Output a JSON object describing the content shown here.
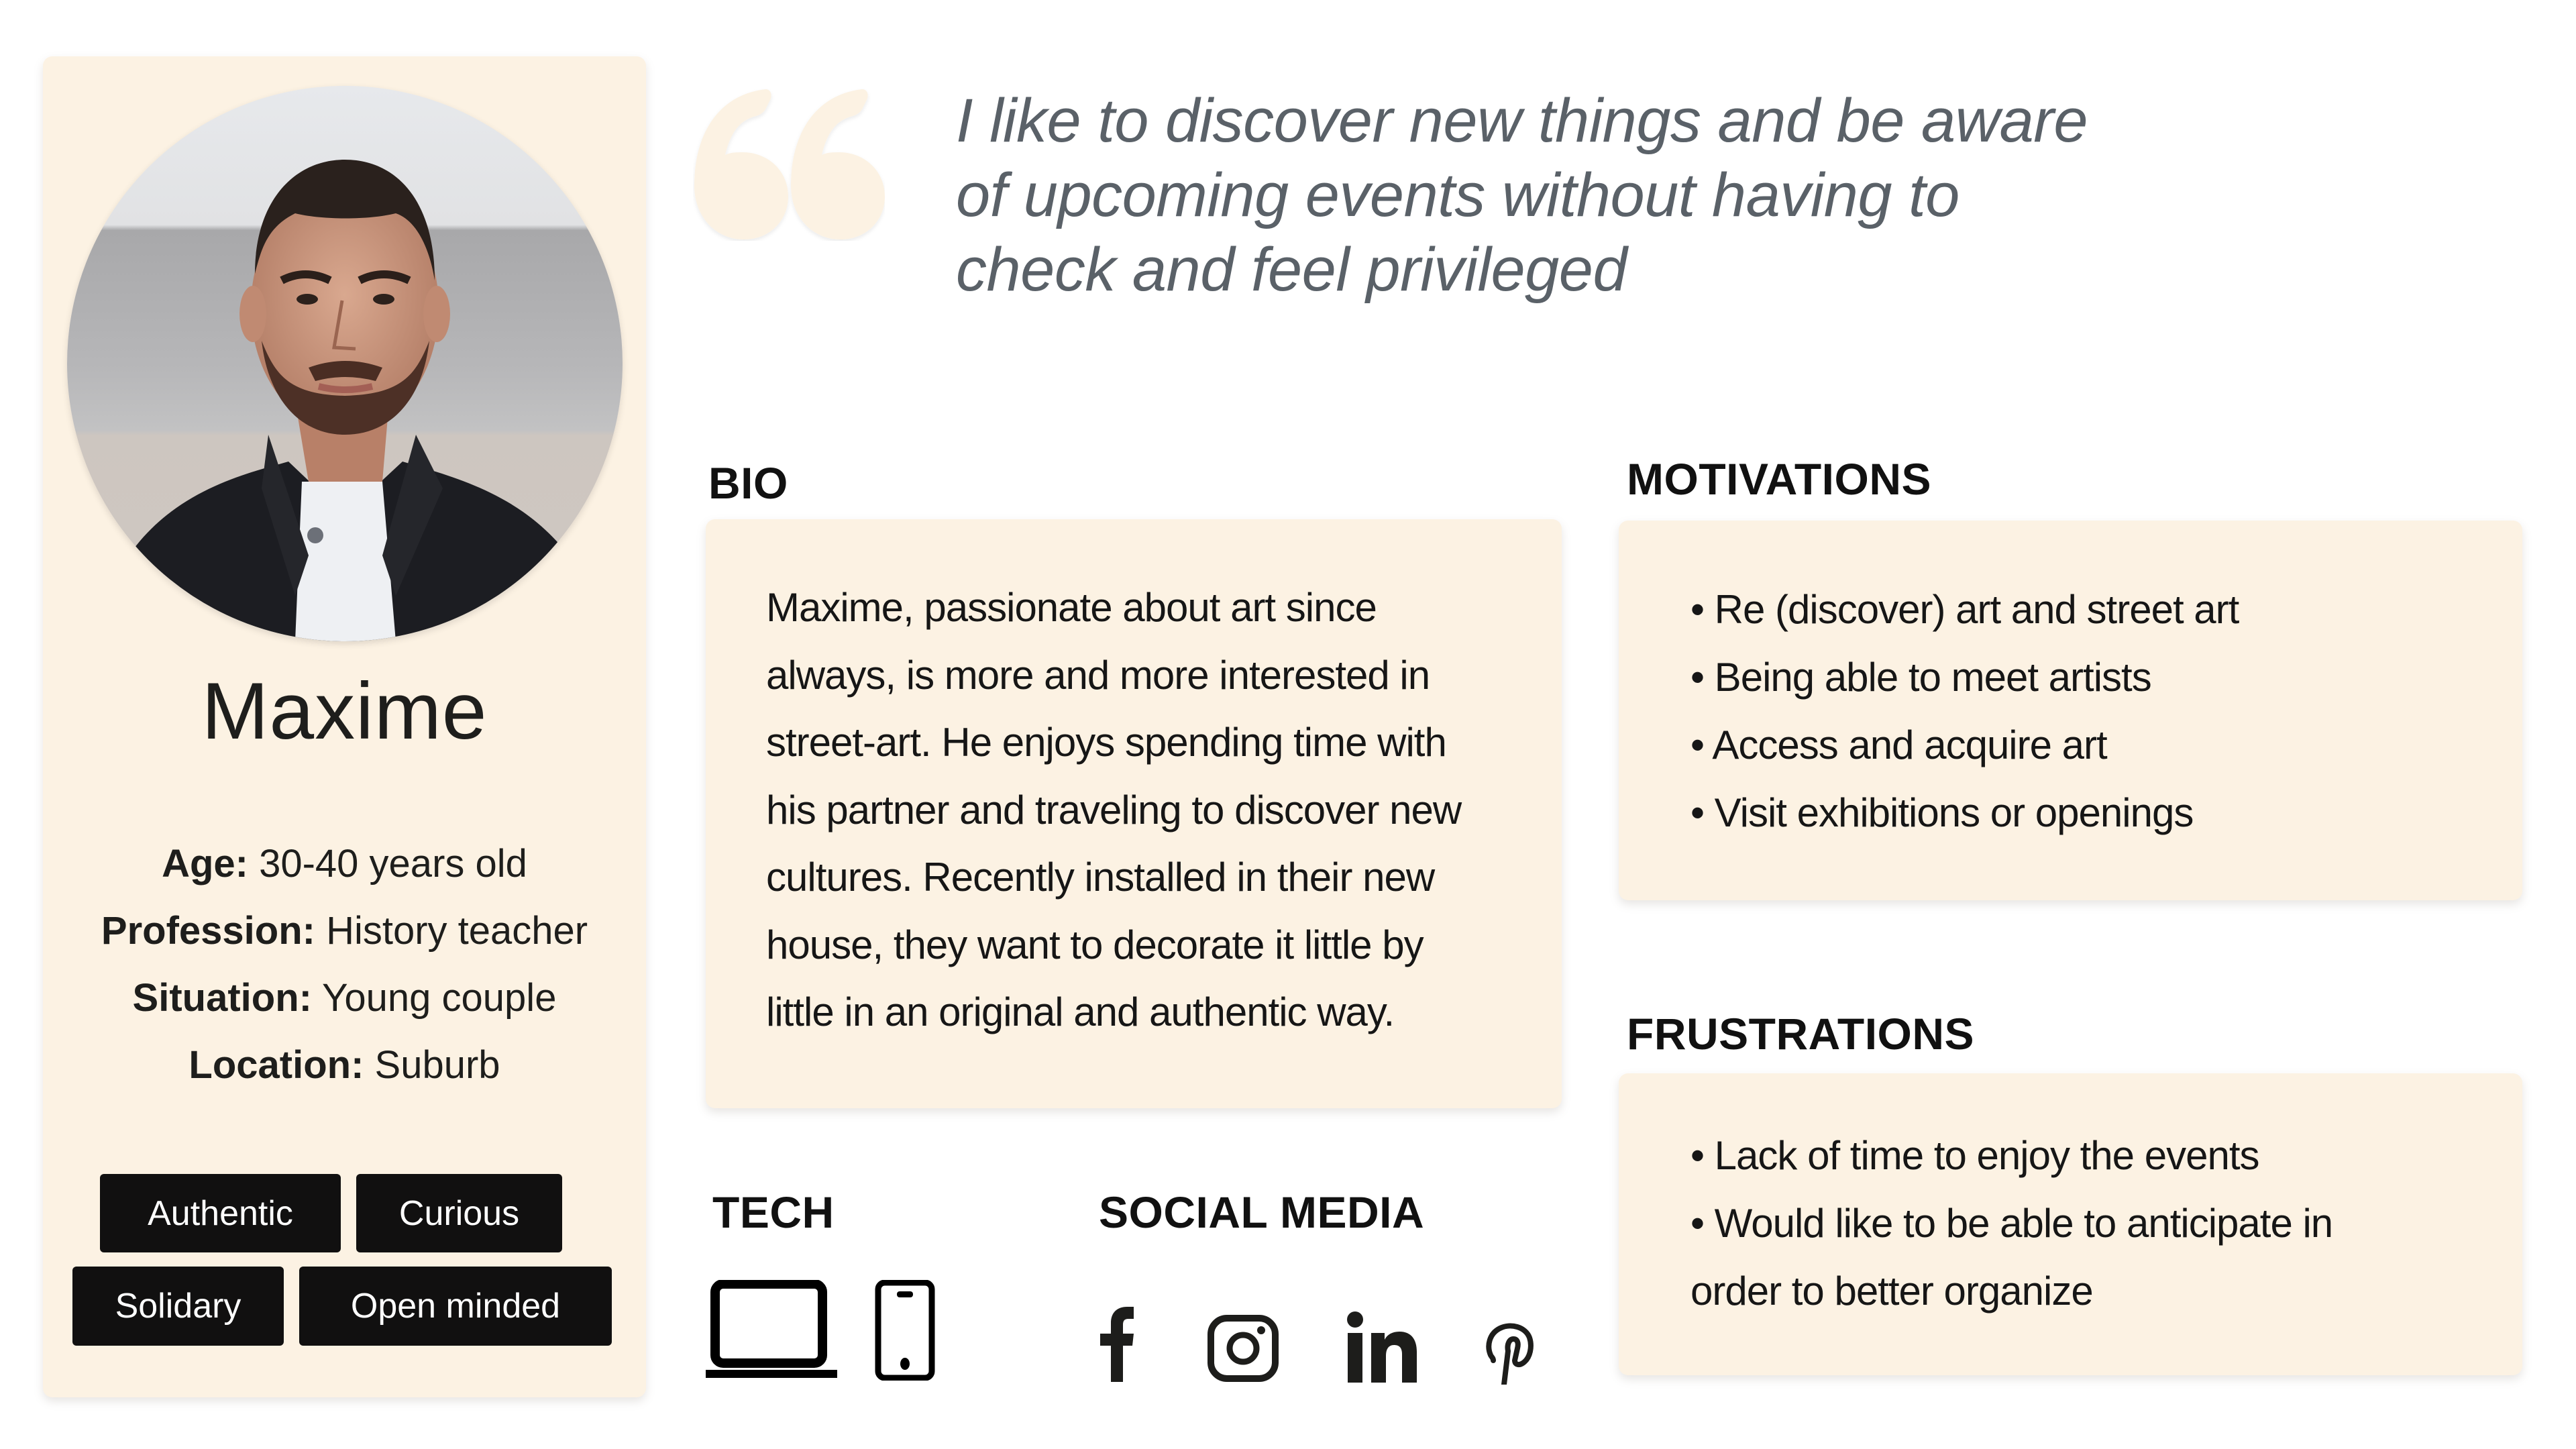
{
  "persona": {
    "name": "Maxime",
    "photo_alt": "Portrait of Maxime",
    "details": [
      {
        "label": "Age:",
        "value": "30-40 years old"
      },
      {
        "label": "Profession:",
        "value": "History teacher"
      },
      {
        "label": "Situation:",
        "value": "Young couple"
      },
      {
        "label": "Location:",
        "value": "Suburb"
      }
    ],
    "tags": [
      "Authentic",
      "Curious",
      "Solidary",
      "Open minded"
    ]
  },
  "quote": {
    "icon": "quote-mark-icon",
    "lines": [
      "I like to discover new things and be aware",
      "of upcoming events without having to",
      "check and feel privileged"
    ]
  },
  "bio": {
    "title": "BIO",
    "lines": [
      "Maxime, passionate about art since",
      "always, is more and more interested in",
      "street-art. He enjoys spending time with",
      "his partner and traveling to discover new",
      "cultures. Recently installed in their new",
      "house, they want to decorate it little by",
      "little in an original and authentic way."
    ]
  },
  "motivations": {
    "title": "MOTIVATIONS",
    "items": [
      "• Re (discover) art and street art",
      "• Being able to meet artists",
      "• Access and acquire art",
      "• Visit exhibitions or openings"
    ]
  },
  "frustrations": {
    "title": "FRUSTRATIONS",
    "items": [
      "• Lack of time to enjoy the events",
      "• Would like to be able to anticipate in",
      "order to better organize"
    ]
  },
  "tech": {
    "title": "TECH",
    "icons": [
      "laptop-icon",
      "smartphone-icon"
    ]
  },
  "social_media": {
    "title": "SOCIAL MEDIA",
    "icons": [
      "facebook-icon",
      "instagram-icon",
      "linkedin-icon",
      "pinterest-icon"
    ]
  },
  "colors": {
    "card_background": "#fcf2e3",
    "tag_background": "#111010",
    "tag_text": "#ffffff",
    "quote_text": "#5a6168",
    "heading_text": "#111111"
  }
}
